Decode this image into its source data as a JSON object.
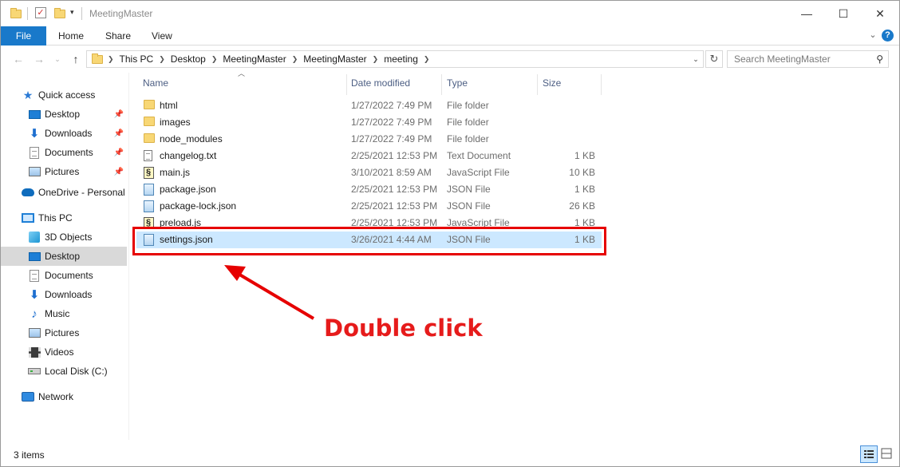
{
  "window": {
    "title": "MeetingMaster",
    "controls": {
      "minimize": "—",
      "maximize": "☐",
      "close": "✕"
    }
  },
  "ribbon": {
    "tabs": [
      "File",
      "Home",
      "Share",
      "View"
    ],
    "help": "?",
    "accent": "#1979ca"
  },
  "address": {
    "crumbs": [
      "This PC",
      "Desktop",
      "MeetingMaster",
      "MeetingMaster",
      "meeting"
    ],
    "search_placeholder": "Search MeetingMaster"
  },
  "nav_pane": {
    "items": [
      {
        "label": "Quick access",
        "icon": "star-icon"
      },
      {
        "label": "Desktop",
        "icon": "desktop-icon",
        "pinned": true
      },
      {
        "label": "Downloads",
        "icon": "download-icon",
        "pinned": true
      },
      {
        "label": "Documents",
        "icon": "documents-icon",
        "pinned": true
      },
      {
        "label": "Pictures",
        "icon": "pictures-icon",
        "pinned": true
      },
      {
        "label": "OneDrive - Personal",
        "icon": "cloud-icon"
      },
      {
        "label": "This PC",
        "icon": "computer-icon"
      },
      {
        "label": "3D Objects",
        "icon": "3d-objects-icon"
      },
      {
        "label": "Desktop",
        "icon": "desktop-icon",
        "selected": true
      },
      {
        "label": "Documents",
        "icon": "documents-icon"
      },
      {
        "label": "Downloads",
        "icon": "download-icon"
      },
      {
        "label": "Music",
        "icon": "music-icon"
      },
      {
        "label": "Pictures",
        "icon": "pictures-icon"
      },
      {
        "label": "Videos",
        "icon": "videos-icon"
      },
      {
        "label": "Local Disk (C:)",
        "icon": "disk-icon"
      },
      {
        "label": "Network",
        "icon": "network-icon"
      }
    ]
  },
  "file_list": {
    "columns": [
      "Name",
      "Date modified",
      "Type",
      "Size"
    ],
    "rows": [
      {
        "name": "html",
        "date": "1/27/2022 7:49 PM",
        "type": "File folder",
        "size": "",
        "icon": "folder-icon"
      },
      {
        "name": "images",
        "date": "1/27/2022 7:49 PM",
        "type": "File folder",
        "size": "",
        "icon": "folder-icon"
      },
      {
        "name": "node_modules",
        "date": "1/27/2022 7:49 PM",
        "type": "File folder",
        "size": "",
        "icon": "folder-icon"
      },
      {
        "name": "changelog.txt",
        "date": "2/25/2021 12:53 PM",
        "type": "Text Document",
        "size": "1 KB",
        "icon": "text-file-icon"
      },
      {
        "name": "main.js",
        "date": "3/10/2021 8:59 AM",
        "type": "JavaScript File",
        "size": "10 KB",
        "icon": "script-file-icon"
      },
      {
        "name": "package.json",
        "date": "2/25/2021 12:53 PM",
        "type": "JSON File",
        "size": "1 KB",
        "icon": "json-file-icon"
      },
      {
        "name": "package-lock.json",
        "date": "2/25/2021 12:53 PM",
        "type": "JSON File",
        "size": "26 KB",
        "icon": "json-file-icon"
      },
      {
        "name": "preload.js",
        "date": "2/25/2021 12:53 PM",
        "type": "JavaScript File",
        "size": "1 KB",
        "icon": "script-file-icon"
      },
      {
        "name": "settings.json",
        "date": "3/26/2021 4:44 AM",
        "type": "JSON File",
        "size": "1 KB",
        "icon": "json-file-icon",
        "highlighted": true
      }
    ]
  },
  "annotation": {
    "label": "Double click",
    "color": "#e60000"
  },
  "status_bar": {
    "item_count": "3 items"
  }
}
